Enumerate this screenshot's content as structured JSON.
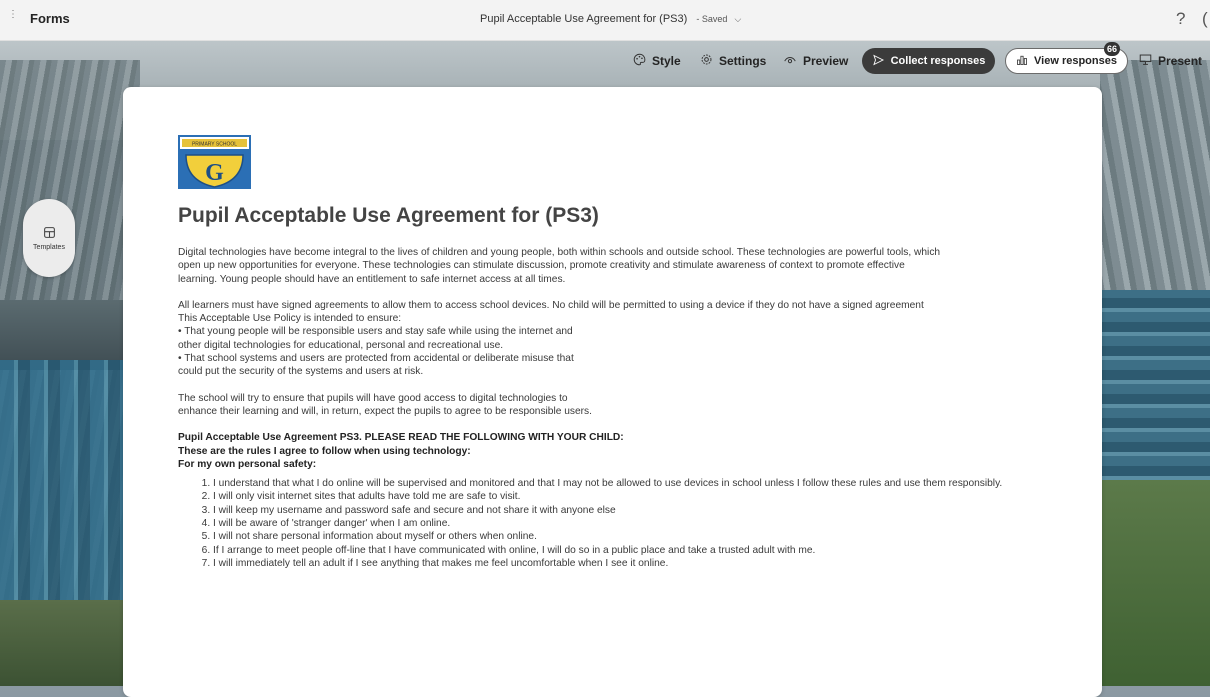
{
  "app": {
    "brand": "Forms"
  },
  "header": {
    "doc_title": "Pupil Acceptable Use Agreement for (PS3)",
    "saved": "- Saved",
    "help_icon": "?"
  },
  "toolbar": {
    "style_label": "Style",
    "settings_label": "Settings",
    "preview_label": "Preview",
    "collect_label": "Collect responses",
    "view_label": "View responses",
    "response_count": "66",
    "present_label": "Present"
  },
  "sidebar": {
    "templates_label": "Templates"
  },
  "form": {
    "title": "Pupil Acceptable Use Agreement for (PS3)",
    "para1": [
      "Digital technologies have become integral to the lives of children and young people, both within schools and outside school. These technologies are powerful tools, which",
      "open up new opportunities for everyone. These technologies can stimulate discussion, promote creativity and stimulate awareness of context to promote effective",
      "learning. Young people should have an entitlement to safe internet access at all times."
    ],
    "para2": [
      "All learners  must have signed agreements to allow them to access school devices.  No child will be permitted to using a device if they do not have a signed agreement",
      "This Acceptable Use Policy is intended to ensure:",
      "• That young people will be responsible users and stay safe while using the internet and",
      "other digital technologies for educational, personal and recreational use.",
      "• That school systems and users are protected from accidental or deliberate misuse that",
      "could put the security of the systems and users at risk."
    ],
    "para3": [
      "The school will try to ensure that pupils will have good access to digital technologies to",
      "enhance their learning and will, in return, expect the pupils to agree to be responsible users."
    ],
    "bold_heading": [
      "Pupil Acceptable Use Agreement PS3. PLEASE READ THE FOLLOWING WITH YOUR CHILD:",
      "These are the rules I agree to follow when using technology:",
      "For my own personal safety:"
    ],
    "rules": [
      "I understand that what I do online will be supervised and monitored and that I may not be allowed to use devices in school unless I follow these rules and use them responsibly.",
      "I will only visit internet sites that adults have told me are safe to visit.",
      "I will keep my username and password safe and secure and not share it with anyone else",
      "I will be aware of 'stranger danger' when I am online.",
      "I will not share personal information about myself or others when online.",
      "If I arrange to meet people off-line that I have communicated with online, I will do so in a public place and take a trusted adult with me.",
      "I will immediately tell an adult if I see anything that makes me feel uncomfortable when I see it online."
    ],
    "logo_letter": "G"
  }
}
